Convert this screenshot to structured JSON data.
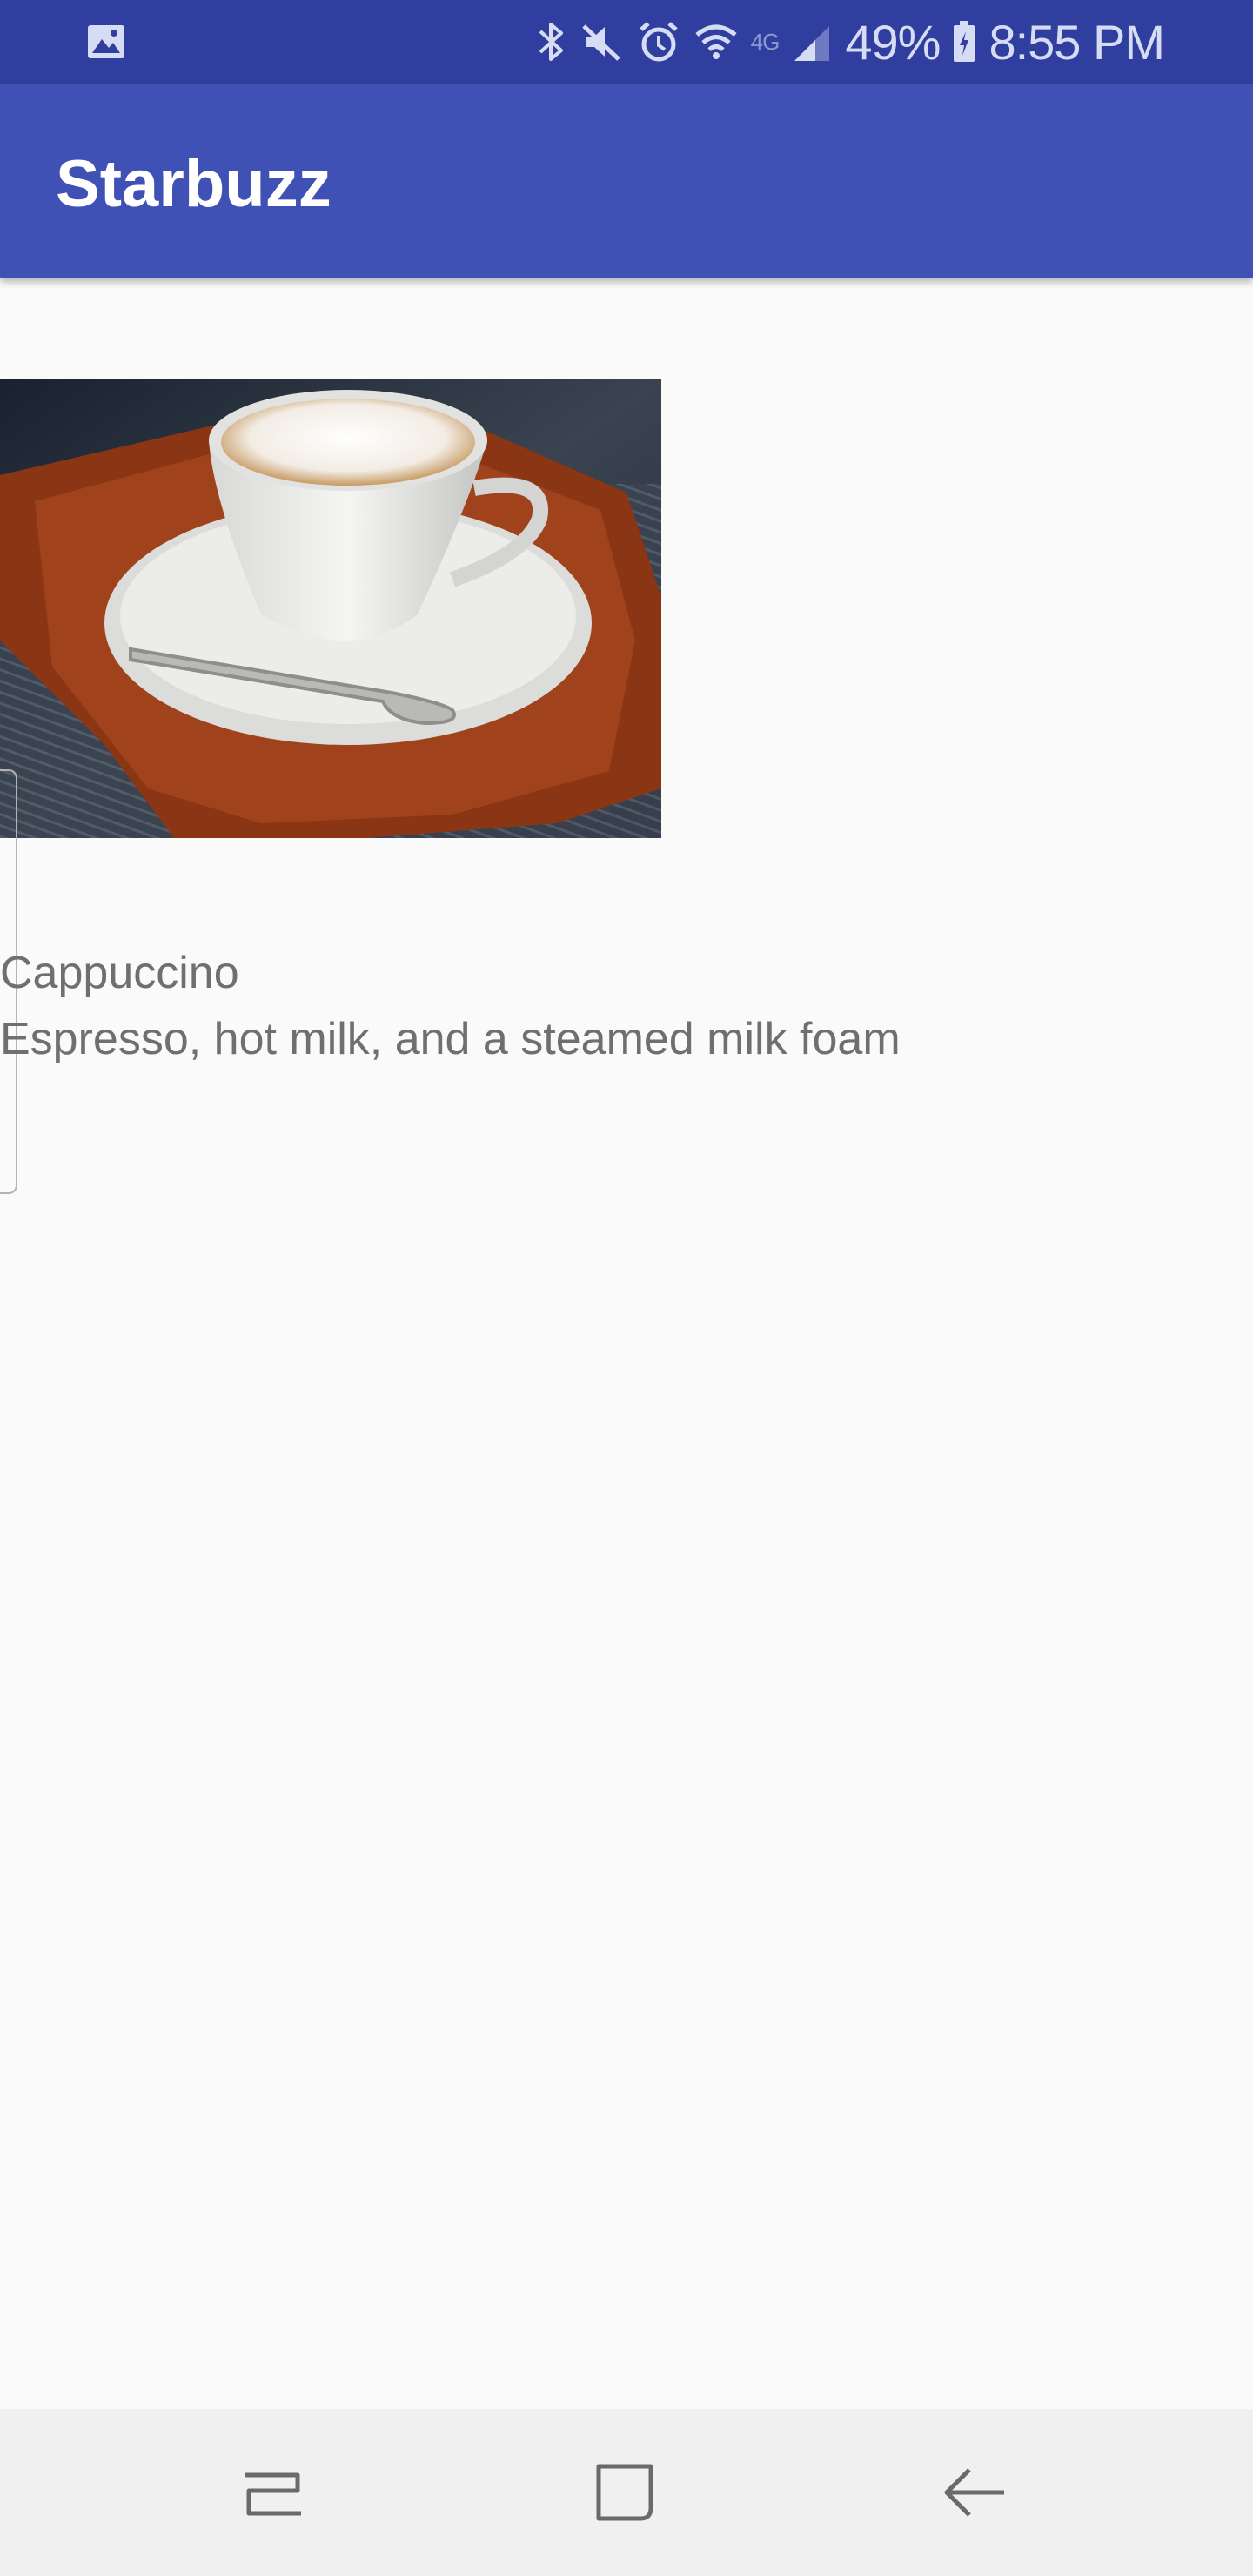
{
  "status_bar": {
    "battery_percent": "49%",
    "time": "8:55 PM",
    "network_label": "4G",
    "icons": [
      "image-notification-icon",
      "bluetooth-icon",
      "mute-icon",
      "alarm-icon",
      "wifi-icon",
      "lte-icon",
      "signal-icon",
      "battery-icon"
    ]
  },
  "app_bar": {
    "title": "Starbuzz"
  },
  "drink": {
    "image": "cappuccino-photo",
    "name": "Cappuccino",
    "description": "Espresso, hot milk, and a steamed milk foam"
  },
  "nav_bar": {
    "icons": [
      "recents-icon",
      "home-icon",
      "back-icon"
    ]
  },
  "colors": {
    "status_bar": "#303f9f",
    "app_bar": "#3f51b5",
    "background": "#fafafa",
    "text": "#6f6f6f"
  }
}
